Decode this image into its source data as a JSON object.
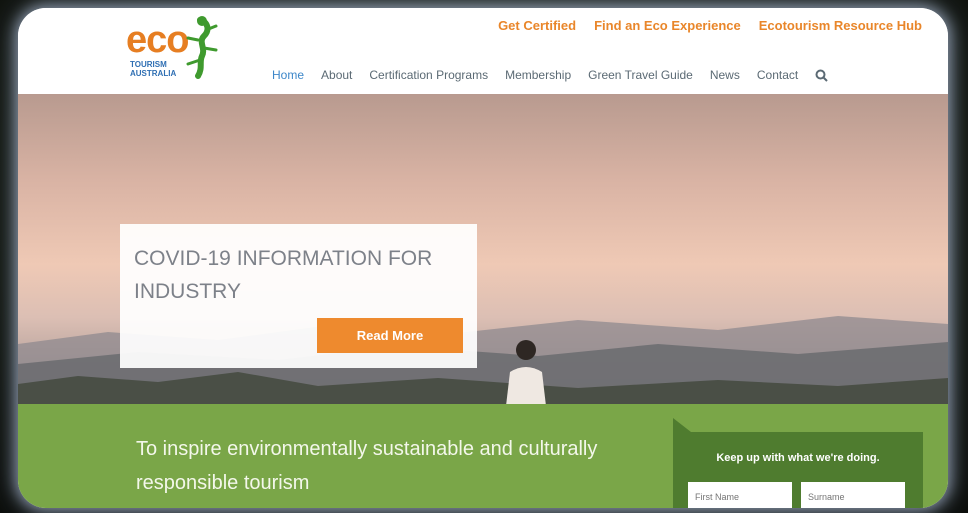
{
  "logo": {
    "main": "eco",
    "line1": "TOURISM",
    "line2": "AUSTRALIA"
  },
  "top_links": [
    "Get Certified",
    "Find an Eco Experience",
    "Ecotourism Resource Hub"
  ],
  "nav": {
    "items": [
      "Home",
      "About",
      "Certification Programs",
      "Membership",
      "Green Travel Guide",
      "News",
      "Contact"
    ],
    "active": "Home"
  },
  "hero": {
    "card_title": "COVID-19 INFORMATION FOR INDUSTRY",
    "button_label": "Read More"
  },
  "band": {
    "mission": "To inspire environmentally sustainable and culturally responsible tourism",
    "signup_title": "Keep up with what we're doing.",
    "first_name_placeholder": "First Name",
    "surname_placeholder": "Surname"
  },
  "colors": {
    "orange": "#ee8a2e",
    "green": "#7aa648",
    "dark_green": "#4f7c2f",
    "blue": "#3d87c9"
  }
}
